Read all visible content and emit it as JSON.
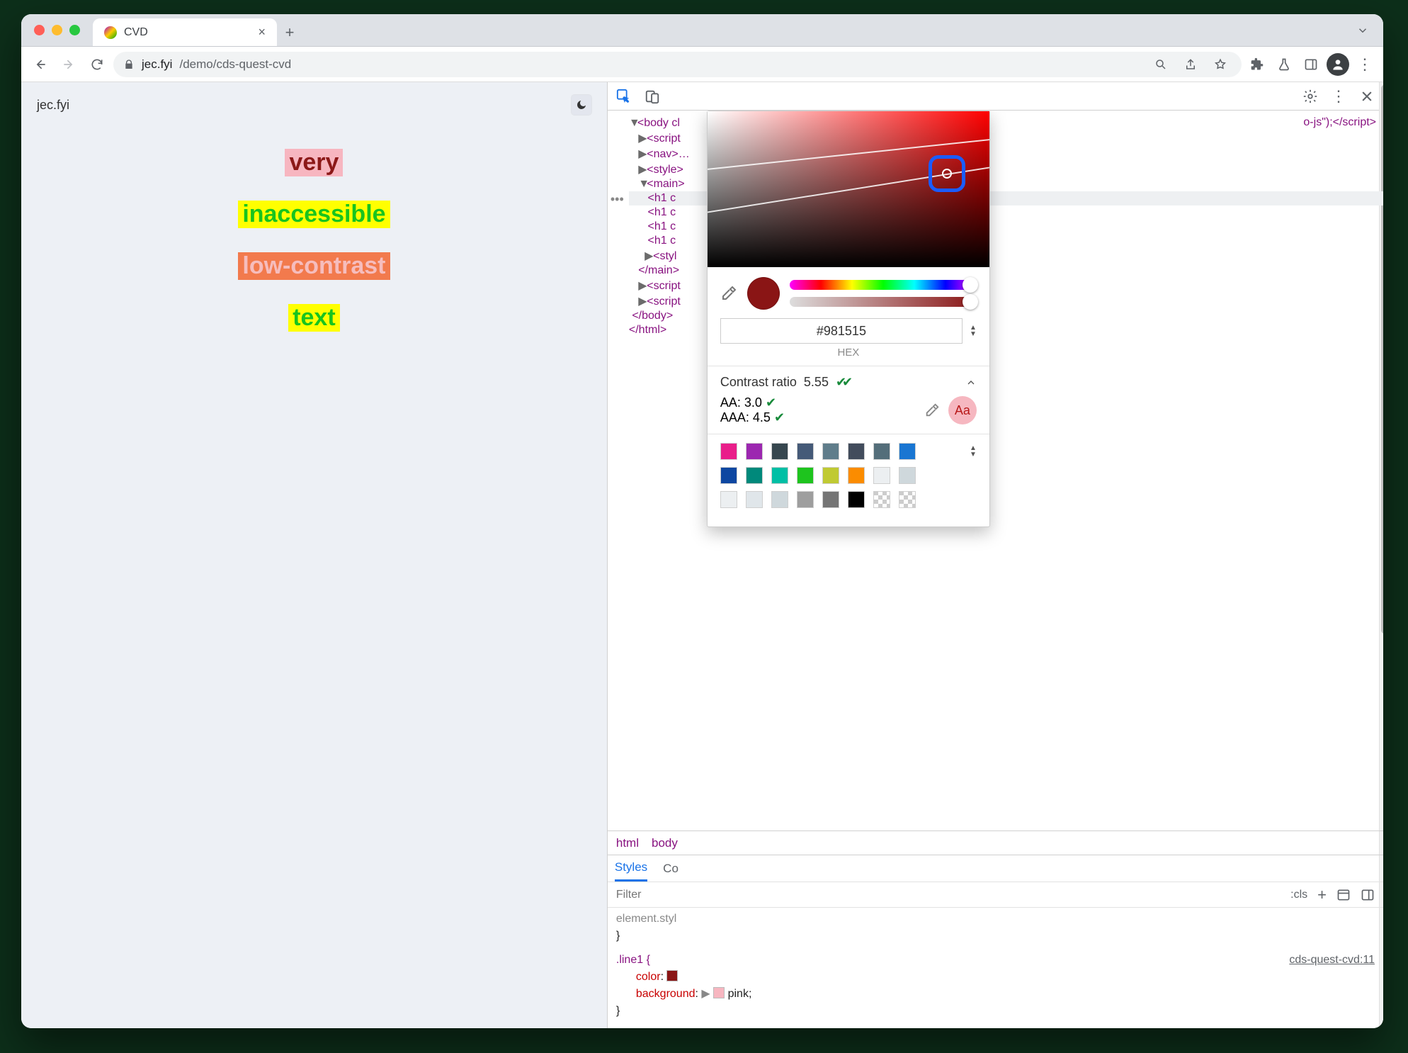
{
  "browser": {
    "tab_title": "CVD",
    "close_glyph": "×",
    "new_tab_glyph": "+",
    "chevron_glyph": "⌄",
    "url_host": "jec.fyi",
    "url_path": "/demo/cds-quest-cvd",
    "tabs_dropdown": "⌄",
    "menu_glyph": "⋮"
  },
  "page": {
    "site_label": "jec.fyi",
    "dark_icon": "moon",
    "words": {
      "w1": "very",
      "w2": "inaccessible",
      "w3": "low-contrast",
      "w4": "text"
    }
  },
  "devtools": {
    "script_tail": "o-js\");</script>",
    "dom": {
      "body_open": "<body cl",
      "script_open": "<script",
      "nav": "<nav>…",
      "style": "<style>",
      "main_open": "<main>",
      "h1a": "<h1 c",
      "h1b": "<h1 c",
      "h1c": "<h1 c",
      "h1d": "<h1 c",
      "style2": "<styl",
      "main_close": "</main>",
      "script2": "<script",
      "script3": "<script",
      "body_close": "</body>",
      "html_close": "</html>"
    },
    "crumbs": {
      "a": "html",
      "b": "body"
    },
    "styles_tab": "Styles",
    "computed_tab": "Co",
    "filter_placeholder": "Filter",
    "actions": {
      "cls": ":cls",
      "plus": "+"
    },
    "css": {
      "rule0": "element.styl",
      "brace_close": "}",
      "rule1_sel": ".line1 {",
      "rule1_prop": "color",
      "rule1_swatch": "#8a1515",
      "rule2_prop": "background",
      "rule2_val": "pink",
      "rule2_swatch": "#f7b6c0",
      "source_link": "cds-quest-cvd:11"
    }
  },
  "picker": {
    "hex_value": "#981515",
    "hex_label": "HEX",
    "contrast_label": "Contrast ratio",
    "contrast_value": "5.55",
    "aa_label": "AA: 3.0",
    "aaa_label": "AAA: 4.5",
    "aa_badge": "Aa",
    "palette": {
      "row1": [
        "#e91e8a",
        "#9c27b0",
        "#37474f",
        "#455a78",
        "#607d8b",
        "#424c5c",
        "#546e7a",
        "#1976d2"
      ],
      "row2": [
        "#0d47a1",
        "#00897b",
        "#00bfa5",
        "#1ec41e",
        "#c0ca33",
        "#fb8c00",
        "#eceff1",
        "#cfd8dc"
      ],
      "row3": [
        "#eceff1",
        "#e0e6ea",
        "#cfd8dc",
        "#9e9e9e",
        "#757575",
        "#000000",
        "checker",
        "checker"
      ]
    }
  }
}
